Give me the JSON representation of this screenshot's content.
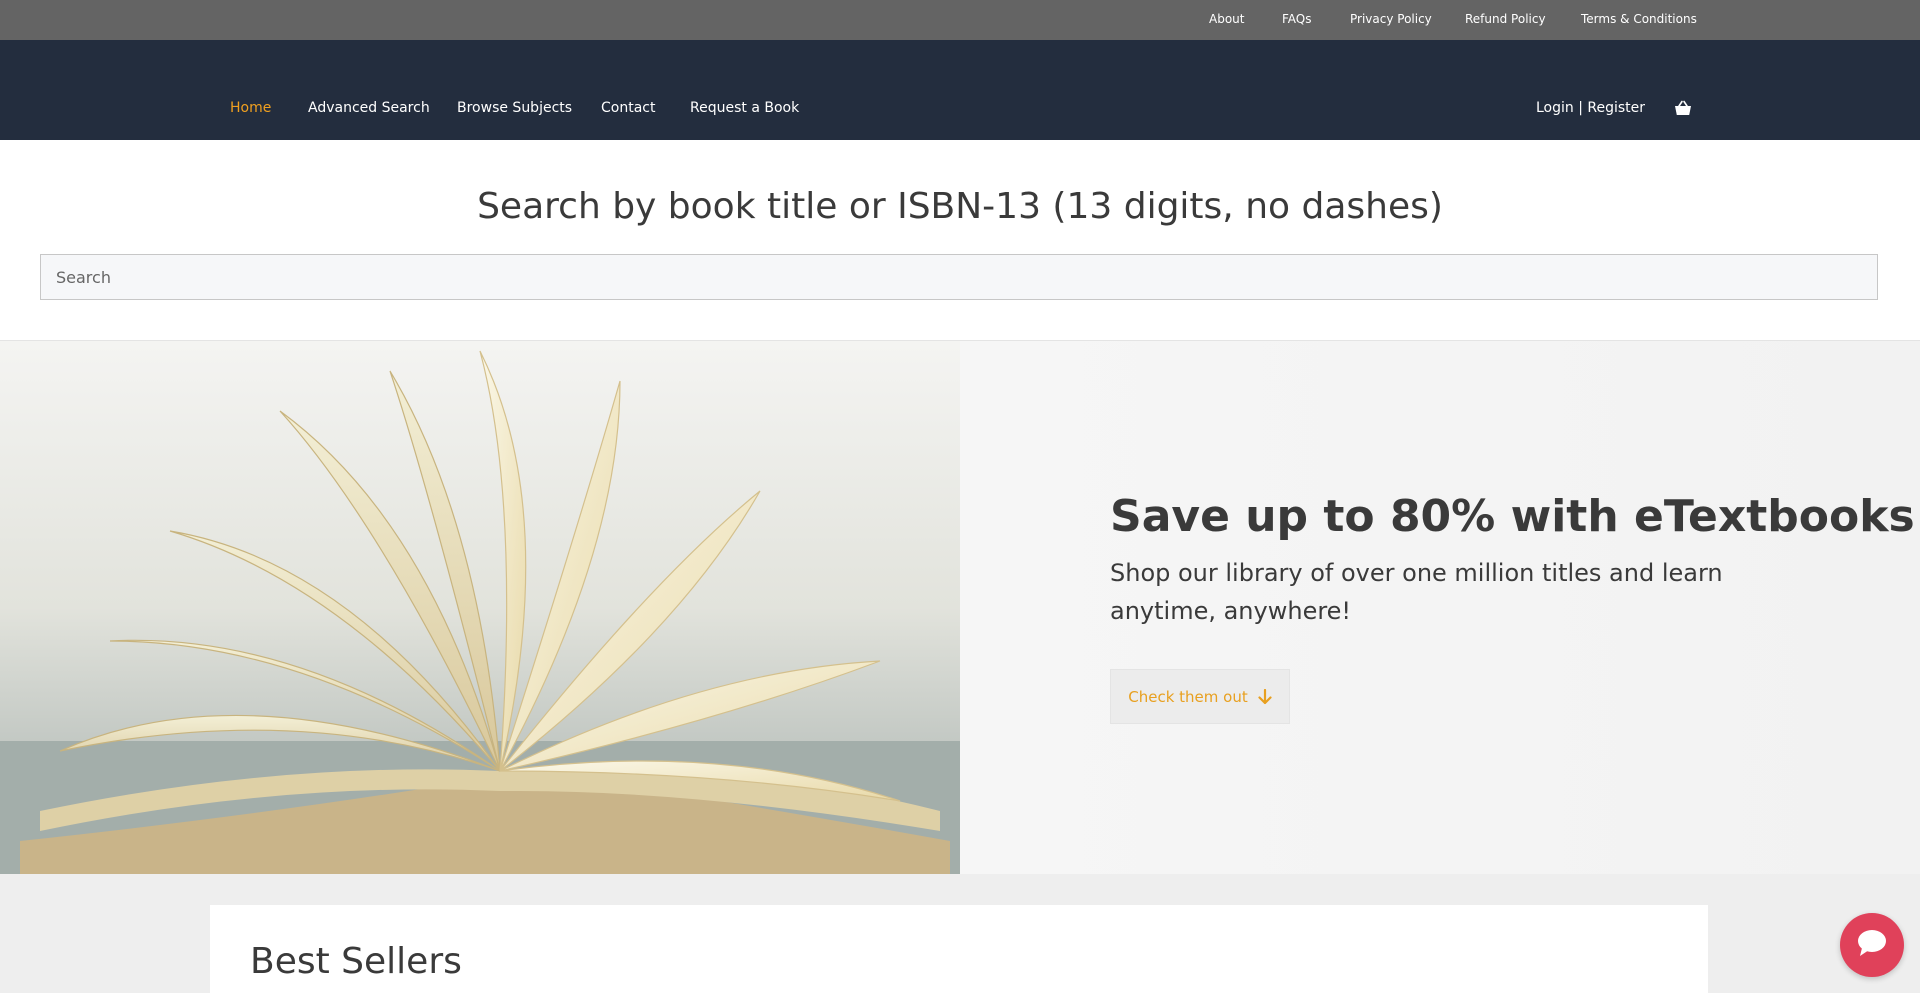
{
  "top_links": [
    "About",
    "FAQs",
    "Privacy Policy",
    "Refund Policy",
    "Terms & Conditions"
  ],
  "nav": {
    "items": [
      "Home",
      "Advanced Search",
      "Browse Subjects",
      "Contact",
      "Request a Book"
    ],
    "active": "Home",
    "login": "Login | Register",
    "cart_icon": "shopping-basket-icon"
  },
  "search": {
    "title": "Search by book title or ISBN-13 (13 digits, no dashes)",
    "placeholder": "Search"
  },
  "hero": {
    "heading": "Save up to 80% with eTextbooks!",
    "subheading": "Shop our library of over one million titles and learn anytime, anywhere!",
    "button_label": "Check them out",
    "button_icon": "arrow-down-icon"
  },
  "bestsellers": {
    "title": "Best Sellers"
  },
  "chat": {
    "icon": "chat-bubble-icon"
  },
  "colors": {
    "topbar": "#646464",
    "navbar": "#232d3e",
    "accent": "#f0a020",
    "chat": "#e0415a"
  }
}
